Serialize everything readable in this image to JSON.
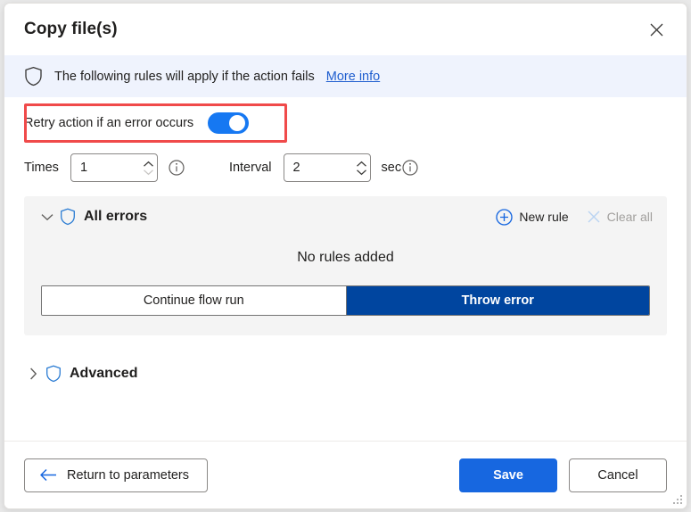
{
  "dialog": {
    "title": "Copy file(s)",
    "close_icon": "close-icon"
  },
  "banner": {
    "icon": "shield-icon",
    "text": "The following rules will apply if the action fails",
    "link_label": "More info"
  },
  "retry": {
    "label": "Retry action if an error occurs",
    "toggle_state": "on",
    "highlight_color": "#f04a4a"
  },
  "retry_fields": {
    "times_label": "Times",
    "times_value": "1",
    "times_info_icon": "info-icon",
    "interval_label": "Interval",
    "interval_value": "2",
    "interval_unit": "sec",
    "interval_info_icon": "info-icon"
  },
  "all_errors": {
    "expand_icon": "chevron-down-icon",
    "shield_icon": "shield-icon",
    "title": "All errors",
    "new_rule_label": "New rule",
    "new_rule_icon": "plus-circle-icon",
    "clear_all_label": "Clear all",
    "clear_all_icon": "close-icon",
    "clear_all_disabled": true,
    "empty_text": "No rules added",
    "options": [
      {
        "label": "Continue flow run",
        "selected": false
      },
      {
        "label": "Throw error",
        "selected": true
      }
    ],
    "selected_color": "#00459f"
  },
  "advanced": {
    "expand_icon": "chevron-right-icon",
    "shield_icon": "shield-icon",
    "title": "Advanced"
  },
  "footer": {
    "return_label": "Return to parameters",
    "return_icon": "arrow-left-icon",
    "save_label": "Save",
    "cancel_label": "Cancel",
    "primary_color": "#1767e0",
    "resize_grip": "resize-grip-icon"
  }
}
